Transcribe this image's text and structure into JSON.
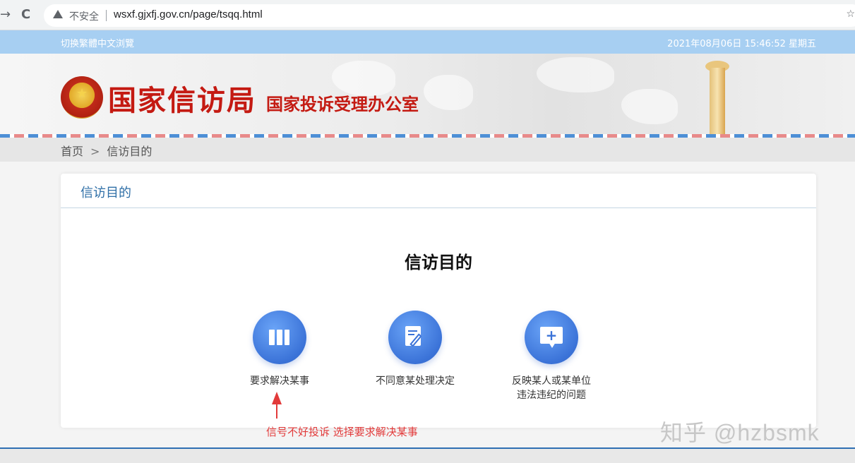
{
  "browser": {
    "back_icon": "→",
    "reload_icon": "C",
    "security_label": "不安全",
    "url": "wsxf.gjxfj.gov.cn/page/tsqq.html",
    "star_icon": "☆"
  },
  "top_strip": {
    "switch_label": "切换繁體中文浏覽",
    "datetime": "2021年08月06日  15:46:52  星期五"
  },
  "header": {
    "title": "国家信访局",
    "subtitle": "国家投诉受理办公室"
  },
  "breadcrumb": {
    "home": "首页",
    "separator": ">",
    "current": "信访目的"
  },
  "card": {
    "header_title": "信访目的",
    "main_title": "信访目的",
    "options": [
      {
        "label_line1": "要求解决某事",
        "label_line2": "",
        "icon": "books-icon"
      },
      {
        "label_line1": "不同意某处理决定",
        "label_line2": "",
        "icon": "edit-document-icon"
      },
      {
        "label_line1": "反映某人或某单位",
        "label_line2": "违法违纪的问题",
        "icon": "chat-plus-icon"
      }
    ]
  },
  "annotation": {
    "text": "信号不好投诉 选择要求解决某事"
  },
  "watermark": {
    "text": "知乎 @hzbsmk"
  },
  "colors": {
    "strip": "#a7cff2",
    "brand_red": "#c41a12",
    "accent_blue": "#3b73d8",
    "annotation_red": "#e23a3a"
  }
}
